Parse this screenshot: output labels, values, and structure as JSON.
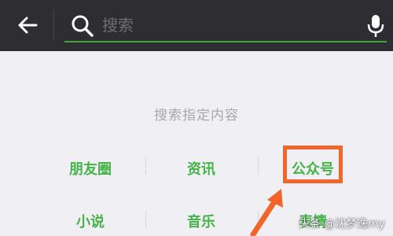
{
  "search": {
    "placeholder": "搜索"
  },
  "section": {
    "title": "搜索指定内容"
  },
  "categories": [
    {
      "label": "朋友圈"
    },
    {
      "label": "资讯"
    },
    {
      "label": "公众号"
    },
    {
      "label": "小说"
    },
    {
      "label": "音乐"
    },
    {
      "label": "表情"
    }
  ],
  "watermark": {
    "text": "头条 @沈梦逸my"
  },
  "colors": {
    "top_bar": "#2e2e32",
    "accent_green": "#46b24a",
    "highlight_orange": "#f0662a",
    "background": "#efeff4"
  },
  "icons": {
    "back": "arrow-left-icon",
    "search": "search-icon",
    "mic": "microphone-icon"
  }
}
